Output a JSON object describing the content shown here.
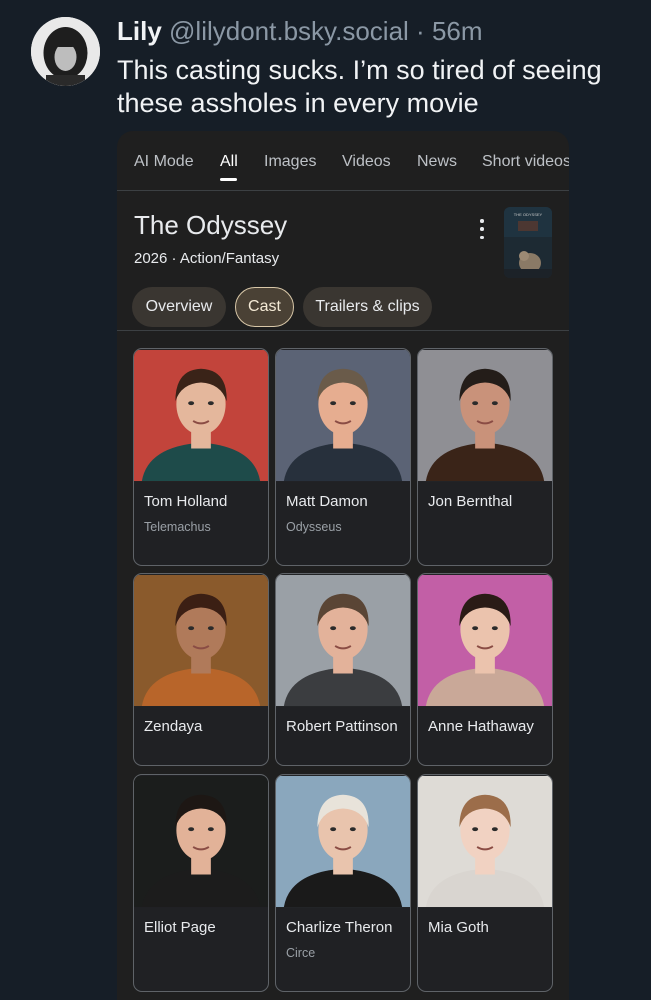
{
  "post": {
    "author_name": "Lily",
    "handle": "@lilydont.bsky.social",
    "separator": "·",
    "time": "56m",
    "text": "This casting sucks. I’m so tired of seeing these assholes in every movie"
  },
  "search": {
    "tabs": [
      {
        "label": "AI Mode",
        "active": false
      },
      {
        "label": "All",
        "active": true
      },
      {
        "label": "Images",
        "active": false
      },
      {
        "label": "Videos",
        "active": false
      },
      {
        "label": "News",
        "active": false
      },
      {
        "label": "Short videos",
        "active": false
      }
    ],
    "title": "The Odyssey",
    "subtitle": "2026 · Action/Fantasy",
    "poster_text": "THE ODYSSEY",
    "chips": [
      {
        "label": "Overview",
        "selected": false
      },
      {
        "label": "Cast",
        "selected": true
      },
      {
        "label": "Trailers & clips",
        "selected": false
      }
    ]
  },
  "cast": [
    {
      "name": "Tom Holland",
      "role": "Telemachus",
      "photo_bg": "#c2443b",
      "skin": "#e4b79c",
      "hair": "#3a2318",
      "outfit": "#1e4b4a"
    },
    {
      "name": "Matt Damon",
      "role": "Odysseus",
      "photo_bg": "#5b6375",
      "skin": "#e6ad90",
      "hair": "#6a5b4a",
      "outfit": "#27303c"
    },
    {
      "name": "Jon Bernthal",
      "role": "",
      "photo_bg": "#8f8f94",
      "skin": "#c9927a",
      "hair": "#241d19",
      "outfit": "#3a2418"
    },
    {
      "name": "Zendaya",
      "role": "",
      "photo_bg": "#8a5a2c",
      "skin": "#b07a5a",
      "hair": "#3b1f14",
      "outfit": "#b8652a"
    },
    {
      "name": "Robert Pattinson",
      "role": "",
      "photo_bg": "#9aa0a6",
      "skin": "#e3b29a",
      "hair": "#5a4535",
      "outfit": "#3b3d40"
    },
    {
      "name": "Anne Hathaway",
      "role": "",
      "photo_bg": "#c25fa6",
      "skin": "#ebc3ad",
      "hair": "#2a1b16",
      "outfit": "#c9a898"
    },
    {
      "name": "Elliot Page",
      "role": "",
      "photo_bg": "#1b1d1c",
      "skin": "#e2b298",
      "hair": "#1d1714",
      "outfit": "#1c1c1c"
    },
    {
      "name": "Charlize Theron",
      "role": "Circe",
      "photo_bg": "#8aa7bd",
      "skin": "#e9c4ad",
      "hair": "#e8e3da",
      "outfit": "#1a1a1a"
    },
    {
      "name": "Mia Goth",
      "role": "",
      "photo_bg": "#dedbd6",
      "skin": "#f1d2c2",
      "hair": "#9c6d4a",
      "outfit": "#d9d5d0"
    }
  ]
}
